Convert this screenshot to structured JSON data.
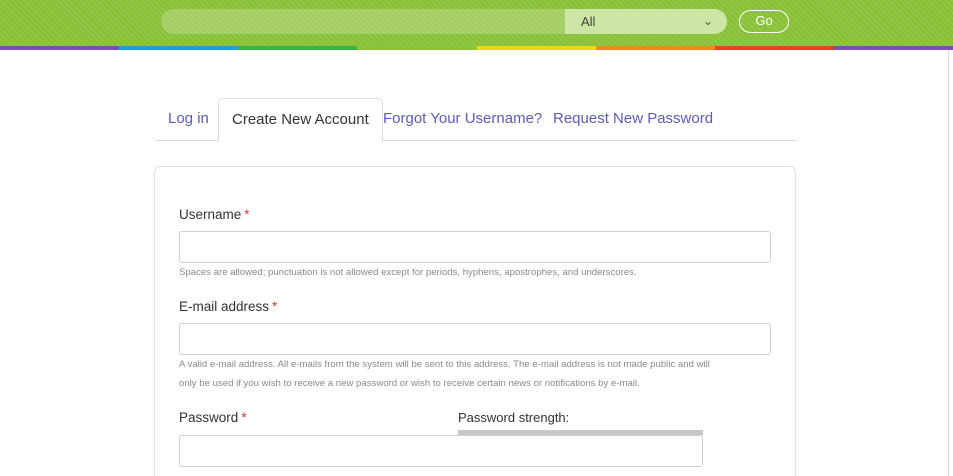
{
  "header": {
    "search_scope": "All",
    "go_label": "Go",
    "strip_colors": [
      "#7b4fb3",
      "#1e9fd8",
      "#3cb04a",
      "#8cc43a",
      "#f4d800",
      "#f08a1c",
      "#e8412c",
      "#7b4fb3"
    ]
  },
  "tabs": [
    {
      "label": "Log in"
    },
    {
      "label": "Create New Account"
    },
    {
      "label": "Forgot Your Username?"
    },
    {
      "label": "Request New Password"
    }
  ],
  "form": {
    "username": {
      "label": "Username",
      "required_mark": "*",
      "value": "",
      "description": "Spaces are allowed; punctuation is not allowed except for periods, hyphens, apostrophes, and underscores."
    },
    "email": {
      "label": "E-mail address",
      "required_mark": "*",
      "value": "",
      "description_line1": "A valid e-mail address. All e-mails from the system will be sent to this address. The e-mail address is not made public and will",
      "description_line2": "only be used if you wish to receive a new password or wish to receive certain news or notifications by e-mail."
    },
    "password": {
      "label": "Password",
      "required_mark": "*",
      "value": "",
      "strength_label": "Password strength:",
      "strength_fraction": 0
    }
  }
}
